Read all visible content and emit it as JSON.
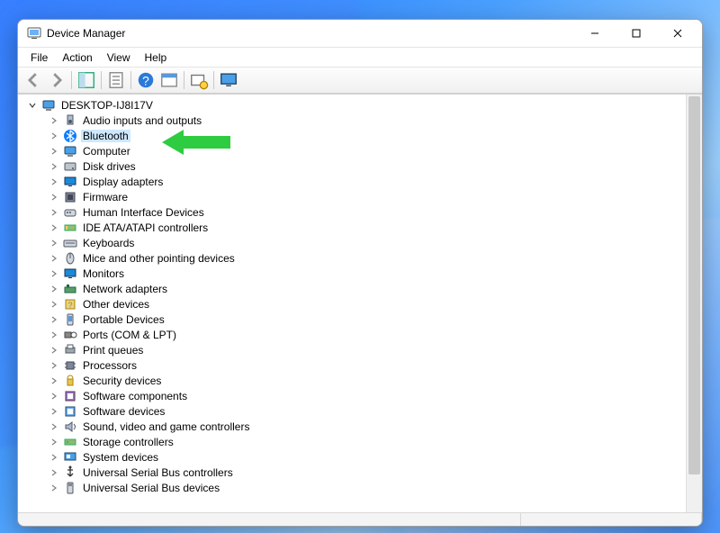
{
  "window": {
    "title": "Device Manager"
  },
  "menu": {
    "file": "File",
    "action": "Action",
    "view": "View",
    "help": "Help"
  },
  "root": {
    "label": "DESKTOP-IJ8I17V"
  },
  "categories": [
    {
      "label": "Audio inputs and outputs",
      "icon": "speaker"
    },
    {
      "label": "Bluetooth",
      "icon": "bluetooth",
      "highlight": true
    },
    {
      "label": "Computer",
      "icon": "computer"
    },
    {
      "label": "Disk drives",
      "icon": "disk"
    },
    {
      "label": "Display adapters",
      "icon": "display"
    },
    {
      "label": "Firmware",
      "icon": "firmware"
    },
    {
      "label": "Human Interface Devices",
      "icon": "hid"
    },
    {
      "label": "IDE ATA/ATAPI controllers",
      "icon": "ide"
    },
    {
      "label": "Keyboards",
      "icon": "keyboard"
    },
    {
      "label": "Mice and other pointing devices",
      "icon": "mouse"
    },
    {
      "label": "Monitors",
      "icon": "monitor"
    },
    {
      "label": "Network adapters",
      "icon": "network"
    },
    {
      "label": "Other devices",
      "icon": "other"
    },
    {
      "label": "Portable Devices",
      "icon": "portable"
    },
    {
      "label": "Ports (COM & LPT)",
      "icon": "ports"
    },
    {
      "label": "Print queues",
      "icon": "printer"
    },
    {
      "label": "Processors",
      "icon": "cpu"
    },
    {
      "label": "Security devices",
      "icon": "security"
    },
    {
      "label": "Software components",
      "icon": "swcomp"
    },
    {
      "label": "Software devices",
      "icon": "swdev"
    },
    {
      "label": "Sound, video and game controllers",
      "icon": "sound"
    },
    {
      "label": "Storage controllers",
      "icon": "storage"
    },
    {
      "label": "System devices",
      "icon": "system"
    },
    {
      "label": "Universal Serial Bus controllers",
      "icon": "usb"
    },
    {
      "label": "Universal Serial Bus devices",
      "icon": "usbdev",
      "clipped": true
    }
  ],
  "annotation": {
    "pointsTo": "Bluetooth",
    "color": "#2ecc40"
  }
}
